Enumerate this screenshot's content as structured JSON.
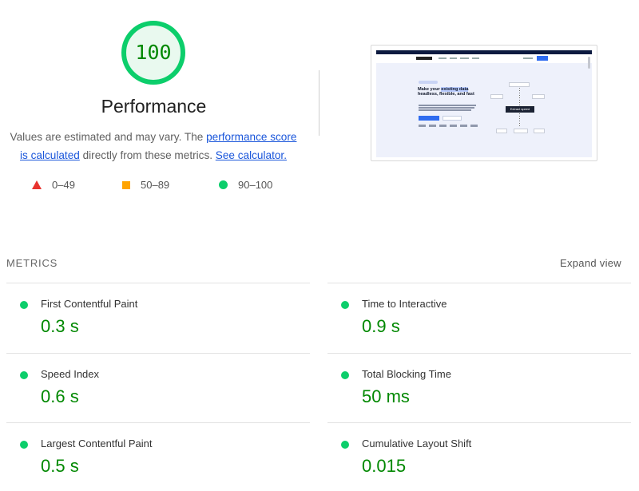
{
  "summary": {
    "score": "100",
    "title": "Performance",
    "desc_pre": "Values are estimated and may vary. The ",
    "desc_link1": "performance score is calculated",
    "desc_mid": " directly from these metrics. ",
    "desc_link2": "See calculator.",
    "score_fraction": 1.0,
    "colors": {
      "pass": "#0cce6b",
      "average": "#ffa400",
      "fail": "#e8332e",
      "score_text": "#008800"
    }
  },
  "legend": [
    {
      "icon": "red-triangle-icon",
      "range": "0–49"
    },
    {
      "icon": "orange-square-icon",
      "range": "50–89"
    },
    {
      "icon": "green-circle-icon",
      "range": "90–100"
    }
  ],
  "thumbnail": {
    "headline_a": "Make your ",
    "headline_hl": "existing data",
    "headline_b": " headless, flexible, and fast",
    "tooltip": "Extract speed"
  },
  "metrics": {
    "header": "METRICS",
    "expand_label": "Expand view",
    "items": [
      {
        "label": "First Contentful Paint",
        "value": "0.3 s"
      },
      {
        "label": "Time to Interactive",
        "value": "0.9 s"
      },
      {
        "label": "Speed Index",
        "value": "0.6 s"
      },
      {
        "label": "Total Blocking Time",
        "value": "50 ms"
      },
      {
        "label": "Largest Contentful Paint",
        "value": "0.5 s"
      },
      {
        "label": "Cumulative Layout Shift",
        "value": "0.015"
      }
    ]
  }
}
